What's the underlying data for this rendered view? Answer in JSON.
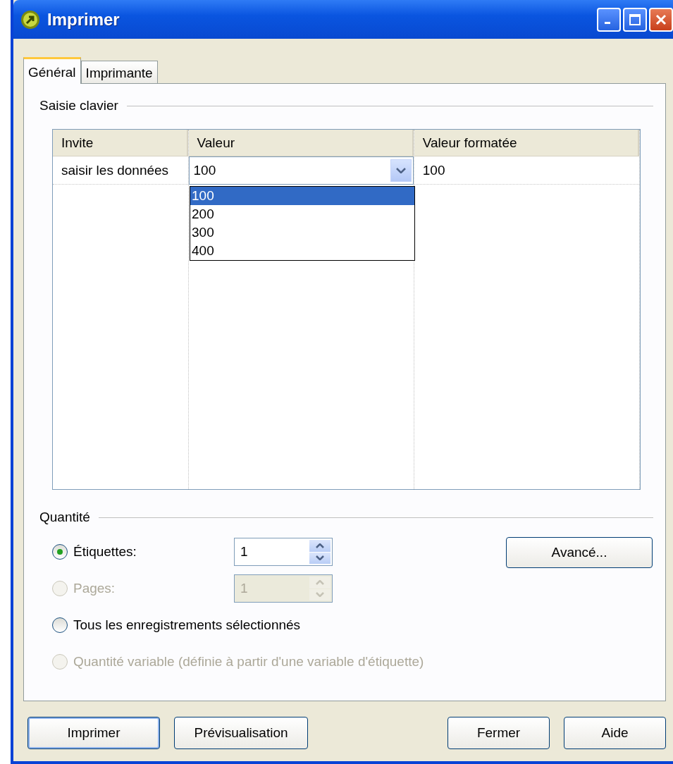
{
  "window": {
    "title": "Imprimer"
  },
  "tabs": [
    {
      "label": "Général",
      "selected": true
    },
    {
      "label": "Imprimante",
      "selected": false
    }
  ],
  "keyboard_input": {
    "title": "Saisie clavier",
    "columns": [
      "Invite",
      "Valeur",
      "Valeur formatée"
    ],
    "rows": [
      {
        "prompt": "saisir les données",
        "value": "100",
        "formatted": "100"
      }
    ],
    "dropdown_options": [
      {
        "label": "100",
        "selected": true
      },
      {
        "label": "200",
        "selected": false
      },
      {
        "label": "300",
        "selected": false
      },
      {
        "label": "400",
        "selected": false
      }
    ]
  },
  "quantity": {
    "title": "Quantité",
    "options": [
      {
        "label": "Étiquettes:",
        "selected": true,
        "disabled": false,
        "spinner": {
          "value": "1",
          "disabled": false
        }
      },
      {
        "label": "Pages:",
        "selected": false,
        "disabled": true,
        "spinner": {
          "value": "1",
          "disabled": true
        }
      },
      {
        "label": "Tous les enregistrements sélectionnés",
        "selected": false,
        "disabled": false
      },
      {
        "label": "Quantité variable (définie à partir d'une variable d'étiquette)",
        "selected": false,
        "disabled": true
      }
    ],
    "advanced_button": "Avancé..."
  },
  "buttons": [
    {
      "label": "Imprimer",
      "default": true
    },
    {
      "label": "Prévisualisation",
      "default": false
    },
    {
      "label": "Fermer",
      "default": false
    },
    {
      "label": "Aide",
      "default": false
    }
  ]
}
